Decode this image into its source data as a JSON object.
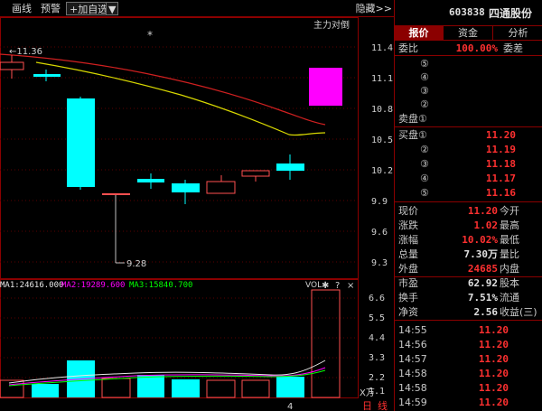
{
  "toolbar": {
    "draw_label": "画线",
    "alert_label": "预警",
    "add_watch_label": "+加自选",
    "dropdown_icon": "▼",
    "hide_label": "隐藏>>"
  },
  "main_chart": {
    "indicator_label": "主力对倒",
    "star": "*",
    "high_label": "←11.36",
    "low_label": "9.28",
    "y_ticks": [
      "11.4",
      "11.1",
      "10.8",
      "10.5",
      "10.2",
      "9.9",
      "9.6",
      "9.3"
    ]
  },
  "volume": {
    "ma1": "MA1:24616.000",
    "ma2": "MA2:19289.600",
    "ma3": "MA3:15840.700",
    "vol_label": "VOL",
    "y_ticks": [
      "6.6",
      "5.5",
      "4.4",
      "3.3",
      "2.2",
      "1.1"
    ],
    "unit": "X万",
    "x_tick": "4",
    "colors": {
      "ma1": "#e8e8e8",
      "ma2": "#ff00ff",
      "ma3": "#00ff00"
    }
  },
  "bottom_tabs": {
    "day": "日",
    "line": "线"
  },
  "panel": {
    "code": "603838",
    "name": "四通股份",
    "tabs": [
      "报价",
      "资金",
      "分析"
    ],
    "weibi_label": "委比",
    "weibi_value": "100.00%",
    "weicha_label": "委差",
    "sell": [
      {
        "label": "⑤",
        "price": "",
        "vol": ""
      },
      {
        "label": "④",
        "price": "",
        "vol": ""
      },
      {
        "label": "③",
        "price": "",
        "vol": ""
      },
      {
        "label": "②",
        "price": "",
        "vol": ""
      },
      {
        "label": "卖盘①",
        "price": "",
        "vol": ""
      }
    ],
    "buy": [
      {
        "label": "买盘①",
        "price": "11.20"
      },
      {
        "label": "②",
        "price": "11.19"
      },
      {
        "label": "③",
        "price": "11.18"
      },
      {
        "label": "④",
        "price": "11.17"
      },
      {
        "label": "⑤",
        "price": "11.16"
      }
    ],
    "stats": [
      {
        "l1": "现价",
        "v1": "11.20",
        "l2": "今开",
        "c": "red"
      },
      {
        "l1": "涨跌",
        "v1": "1.02",
        "l2": "最高",
        "c": "red"
      },
      {
        "l1": "涨幅",
        "v1": "10.02%",
        "l2": "最低",
        "c": "red"
      },
      {
        "l1": "总量",
        "v1": "7.30万",
        "l2": "量比",
        "c": "white"
      },
      {
        "l1": "外盘",
        "v1": "24685",
        "l2": "内盘",
        "c": "red"
      }
    ],
    "stats2": [
      {
        "l1": "市盈",
        "v1": "62.92",
        "l2": "股本",
        "c": "white"
      },
      {
        "l1": "换手",
        "v1": "7.51%",
        "l2": "流通",
        "c": "white"
      },
      {
        "l1": "净资",
        "v1": "2.56",
        "l2": "收益(三)",
        "c": "white"
      }
    ],
    "ticks": [
      {
        "time": "14:55",
        "price": "11.20"
      },
      {
        "time": "14:56",
        "price": "11.20"
      },
      {
        "time": "14:57",
        "price": "11.20"
      },
      {
        "time": "14:58",
        "price": "11.20"
      },
      {
        "time": "14:58",
        "price": "11.20"
      },
      {
        "time": "14:59",
        "price": "11.20"
      },
      {
        "time": "14:59",
        "price": "11.20"
      }
    ]
  }
}
